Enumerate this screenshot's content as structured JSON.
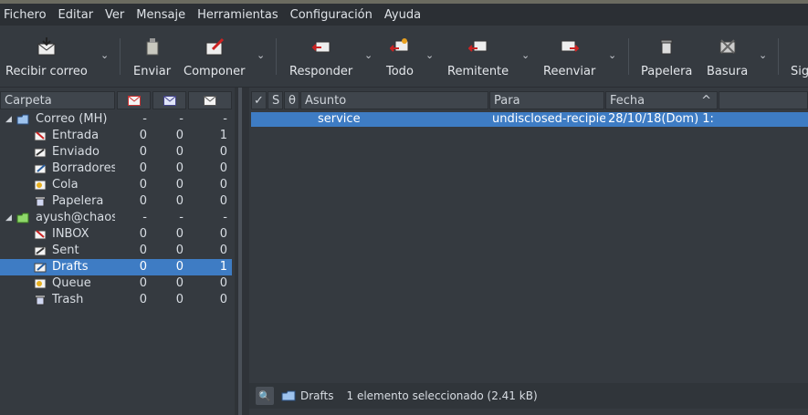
{
  "menu": [
    "Fichero",
    "Editar",
    "Ver",
    "Mensaje",
    "Herramientas",
    "Configuración",
    "Ayuda"
  ],
  "toolbar": {
    "receive": "Recibir correo",
    "send": "Enviar",
    "compose": "Componer",
    "reply": "Responder",
    "reply_all": "Todo",
    "reply_sender": "Remitente",
    "forward": "Reenviar",
    "trash": "Papelera",
    "junk": "Basura",
    "next": "Sig"
  },
  "folder_header": {
    "label": "Carpeta"
  },
  "folders": [
    {
      "name": "Correo (MH)",
      "new": "-",
      "unread": "-",
      "total": "-",
      "level": 0,
      "icon": "mailbox-icon",
      "expanded": true
    },
    {
      "name": "Entrada",
      "new": "0",
      "unread": "0",
      "total": "1",
      "level": 1,
      "icon": "inbox-icon"
    },
    {
      "name": "Enviado",
      "new": "0",
      "unread": "0",
      "total": "0",
      "level": 1,
      "icon": "sent-icon"
    },
    {
      "name": "Borradores",
      "new": "0",
      "unread": "0",
      "total": "0",
      "level": 1,
      "icon": "drafts-icon"
    },
    {
      "name": "Cola",
      "new": "0",
      "unread": "0",
      "total": "0",
      "level": 1,
      "icon": "queue-icon"
    },
    {
      "name": "Papelera",
      "new": "0",
      "unread": "0",
      "total": "0",
      "level": 1,
      "icon": "trash-icon"
    },
    {
      "name": "ayush@chaos",
      "new": "-",
      "unread": "-",
      "total": "-",
      "level": 0,
      "icon": "account-icon",
      "expanded": true
    },
    {
      "name": "INBOX",
      "new": "0",
      "unread": "0",
      "total": "0",
      "level": 1,
      "icon": "inbox-icon"
    },
    {
      "name": "Sent",
      "new": "0",
      "unread": "0",
      "total": "0",
      "level": 1,
      "icon": "sent-icon"
    },
    {
      "name": "Drafts",
      "new": "0",
      "unread": "0",
      "total": "1",
      "level": 1,
      "icon": "drafts-icon",
      "selected": true
    },
    {
      "name": "Queue",
      "new": "0",
      "unread": "0",
      "total": "0",
      "level": 1,
      "icon": "queue-icon"
    },
    {
      "name": "Trash",
      "new": "0",
      "unread": "0",
      "total": "0",
      "level": 1,
      "icon": "trash-icon"
    }
  ],
  "message_columns": {
    "mark": "✓",
    "status": "S",
    "attach": "θ",
    "subject": "Asunto",
    "to": "Para",
    "date": "Fecha"
  },
  "messages": [
    {
      "subject": "service",
      "to": "undisclosed-recipie",
      "date": "28/10/18(Dom) 1:"
    }
  ],
  "status": {
    "folder": "Drafts",
    "text": "1 elemento seleccionado (2.41 kB)"
  },
  "colors": {
    "selection": "#3e7cc4",
    "background": "#353a40"
  }
}
